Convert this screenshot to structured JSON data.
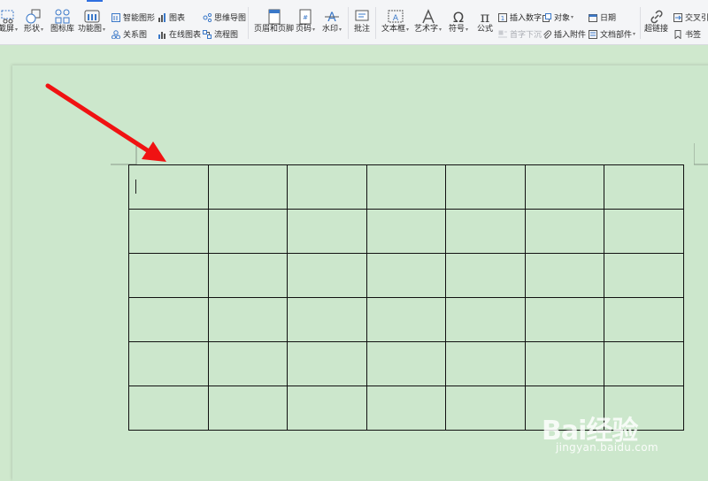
{
  "ribbon": {
    "items_large": [
      {
        "id": "screenshot",
        "label": "截屏",
        "caret": true
      },
      {
        "id": "shape",
        "label": "形状",
        "caret": true
      },
      {
        "id": "icon-lib",
        "label": "图标库",
        "caret": false
      },
      {
        "id": "function-chart",
        "label": "功能图",
        "caret": true
      },
      {
        "id": "header-footer",
        "label": "页眉和页脚",
        "caret": false
      },
      {
        "id": "page-number",
        "label": "页码",
        "caret": true
      },
      {
        "id": "watermark",
        "label": "水印",
        "caret": true
      },
      {
        "id": "comment",
        "label": "批注",
        "caret": false
      },
      {
        "id": "textbox",
        "label": "文本框",
        "caret": true
      },
      {
        "id": "art-text",
        "label": "艺术字",
        "caret": true
      },
      {
        "id": "symbol",
        "label": "符号",
        "caret": true
      },
      {
        "id": "formula",
        "label": "公式",
        "caret": false
      },
      {
        "id": "hyperlink",
        "label": "超链接",
        "caret": false
      }
    ],
    "items_small": [
      {
        "id": "smart-graphic",
        "label": "智能图形",
        "disabled": false
      },
      {
        "id": "relation-chart",
        "label": "关系图",
        "disabled": false
      },
      {
        "id": "chart",
        "label": "图表",
        "disabled": false
      },
      {
        "id": "online-chart",
        "label": "在线图表",
        "disabled": false
      },
      {
        "id": "mind-map",
        "label": "思维导图",
        "disabled": false
      },
      {
        "id": "flow-chart",
        "label": "流程图",
        "disabled": false
      },
      {
        "id": "insert-number",
        "label": "插入数字",
        "disabled": false
      },
      {
        "id": "drop-cap",
        "label": "首字下沉",
        "disabled": true
      },
      {
        "id": "object",
        "label": "对象",
        "disabled": false
      },
      {
        "id": "insert-attachment",
        "label": "插入附件",
        "disabled": false
      },
      {
        "id": "date",
        "label": "日期",
        "disabled": false
      },
      {
        "id": "doc-parts",
        "label": "文档部件",
        "disabled": false
      },
      {
        "id": "cross-ref",
        "label": "交叉引用",
        "disabled": false
      },
      {
        "id": "bookmark",
        "label": "书签",
        "disabled": false
      }
    ]
  },
  "document": {
    "table": {
      "rows": 6,
      "cols": 7
    }
  },
  "watermark": {
    "brand": "Bai经验",
    "site": "jingyan.baidu.com"
  },
  "colors": {
    "page_background": "#cce7cc",
    "arrow": "#f01212",
    "accent": "#2f6fe0"
  }
}
